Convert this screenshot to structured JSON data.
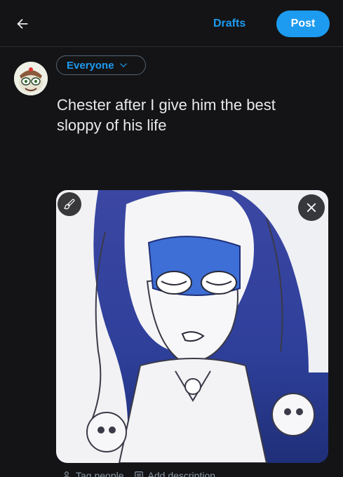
{
  "header": {
    "back_icon": "arrow-left-icon",
    "drafts_label": "Drafts",
    "post_label": "Post"
  },
  "composer": {
    "avatar_icon": "user-avatar",
    "audience_label": "Everyone",
    "text": "Chester after I give him the best\nsloppy of his life"
  },
  "media": {
    "edit_icon": "paintbrush-icon",
    "close_icon": "close-icon",
    "actions": [
      {
        "label": "Tag people",
        "icon": "person-icon"
      },
      {
        "label": "Add description",
        "icon": "description-icon"
      }
    ]
  },
  "colors": {
    "accent": "#1d9bf0",
    "background": "#141416",
    "text": "#e7e9ea",
    "muted": "#8b98a5"
  }
}
